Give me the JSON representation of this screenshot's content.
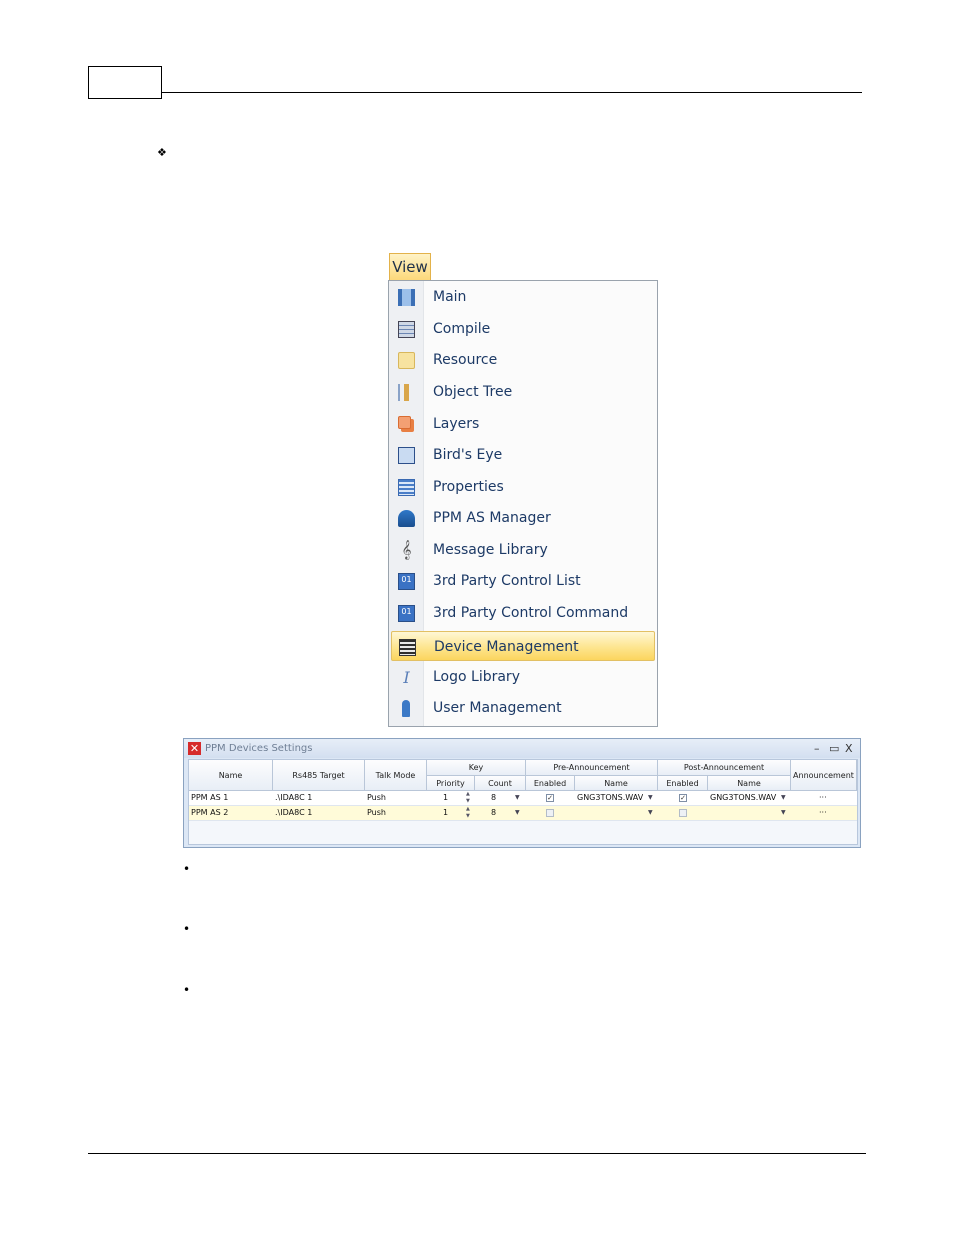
{
  "page": {
    "bullet_diamond": "❖",
    "bullets": [
      "•",
      "•",
      "•"
    ]
  },
  "menu": {
    "tab_label": "View",
    "items": [
      {
        "label": "Main",
        "icon": "main-view-icon"
      },
      {
        "label": "Compile",
        "icon": "compile-icon"
      },
      {
        "label": "Resource",
        "icon": "resource-folder-icon"
      },
      {
        "label": "Object Tree",
        "icon": "object-tree-icon"
      },
      {
        "label": "Layers",
        "icon": "layers-icon"
      },
      {
        "label": "Bird's Eye",
        "icon": "birds-eye-icon"
      },
      {
        "label": "Properties",
        "icon": "properties-icon"
      },
      {
        "label": "PPM AS Manager",
        "icon": "ppm-as-manager-icon"
      },
      {
        "label": "Message Library",
        "icon": "message-library-icon"
      },
      {
        "label": "3rd Party Control List",
        "icon": "control-list-icon"
      },
      {
        "label": "3rd Party Control Command",
        "icon": "control-command-icon"
      },
      {
        "label": "Device Management",
        "icon": "device-management-icon",
        "highlighted": true
      },
      {
        "label": "Logo Library",
        "icon": "logo-library-icon"
      },
      {
        "label": "User Management",
        "icon": "user-management-icon"
      }
    ],
    "highlight_color": "#fbd55e"
  },
  "ppm_window": {
    "title": "PPM Devices Settings",
    "controls": {
      "minimize": "–",
      "maximize": "▭",
      "close": "X"
    },
    "headers": {
      "name": "Name",
      "rs485": "Rs485 Target",
      "talk_mode": "Talk Mode",
      "key": "Key",
      "priority": "Priority",
      "count": "Count",
      "pre": "Pre-Announcement",
      "pre_enabled": "Enabled",
      "pre_name": "Name",
      "post": "Post-Announcement",
      "post_enabled": "Enabled",
      "post_name": "Name",
      "announcement": "Announcement"
    },
    "rows": [
      {
        "name": "PPM AS 1",
        "rs485": ".\\IDA8C 1",
        "talk_mode": "Push",
        "priority": "1",
        "count": "8",
        "pre_enabled": "✓",
        "pre_name": "GNG3TONS.WAV",
        "post_enabled": "✓",
        "post_name": "GNG3TONS.WAV",
        "announcement": "···"
      },
      {
        "name": "PPM AS 2",
        "rs485": ".\\IDA8C 1",
        "talk_mode": "Push",
        "priority": "1",
        "count": "8",
        "pre_enabled": "",
        "pre_name": "",
        "post_enabled": "",
        "post_name": "",
        "announcement": "···"
      }
    ],
    "row_highlight_color": "#fffbd9"
  }
}
